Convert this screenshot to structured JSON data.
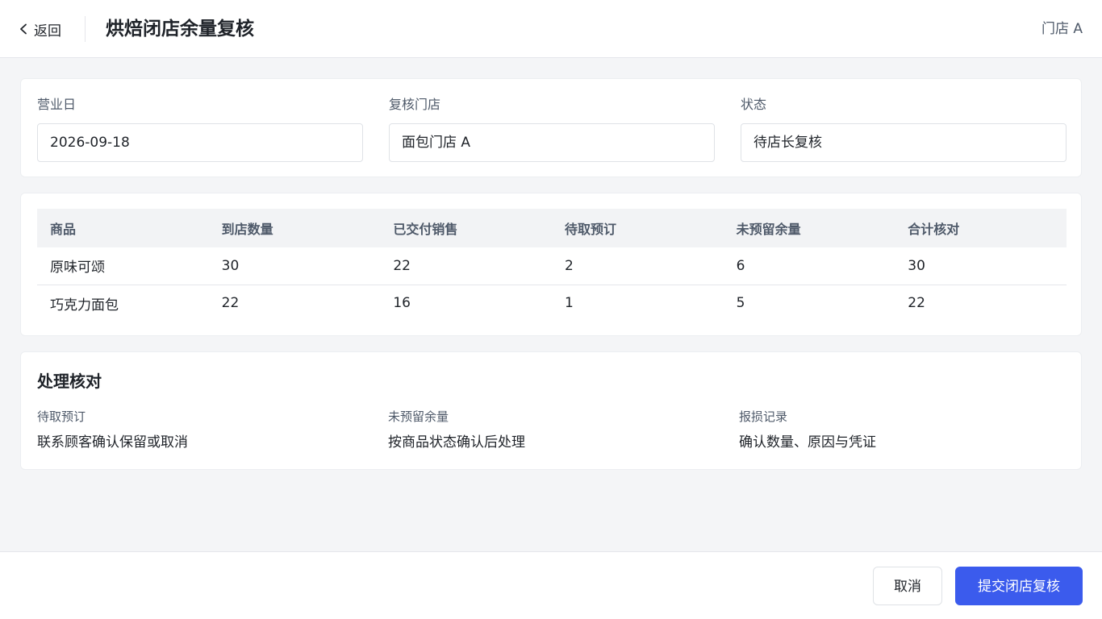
{
  "header": {
    "back_label": "返回",
    "title": "烘焙闭店余量复核",
    "store": "门店 A"
  },
  "meta": {
    "fields": [
      {
        "label": "营业日",
        "value": "2026-09-18"
      },
      {
        "label": "复核门店",
        "value": "面包门店 A"
      },
      {
        "label": "状态",
        "value": "待店长复核"
      }
    ]
  },
  "table": {
    "columns": [
      "商品",
      "到店数量",
      "已交付销售",
      "待取预订",
      "未预留余量",
      "合计核对"
    ],
    "rows": [
      [
        "原味可颂",
        "30",
        "22",
        "2",
        "6",
        "30"
      ],
      [
        "巧克力面包",
        "22",
        "16",
        "1",
        "5",
        "22"
      ]
    ]
  },
  "process": {
    "title": "处理核对",
    "items": [
      {
        "label": "待取预订",
        "value": "联系顾客确认保留或取消"
      },
      {
        "label": "未预留余量",
        "value": "按商品状态确认后处理"
      },
      {
        "label": "报损记录",
        "value": "确认数量、原因与凭证"
      }
    ]
  },
  "footer": {
    "cancel_label": "取消",
    "submit_label": "提交闭店复核"
  },
  "colors": {
    "accent": "#3b5bed",
    "page_bg": "#f4f5f7",
    "table_header_bg": "#f2f3f5"
  }
}
